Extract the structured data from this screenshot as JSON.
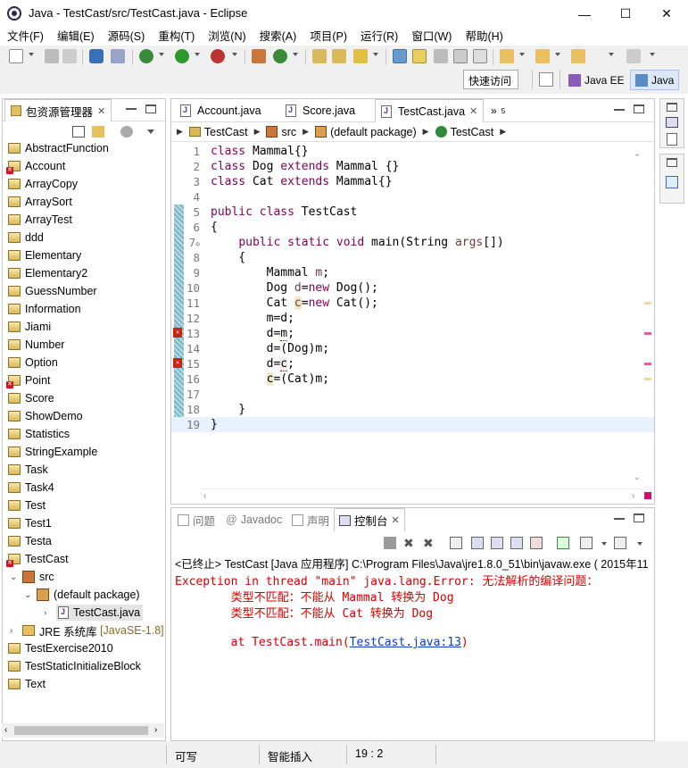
{
  "window": {
    "title": "Java - TestCast/src/TestCast.java - Eclipse",
    "minimize": "—",
    "maximize": "☐",
    "close": "✕"
  },
  "menu": [
    "文件(F)",
    "编辑(E)",
    "源码(S)",
    "重构(T)",
    "浏览(N)",
    "搜索(A)",
    "项目(P)",
    "运行(R)",
    "窗口(W)",
    "帮助(H)"
  ],
  "toolbar": {
    "quick_access": "快速访问",
    "perspective_javaee": "Java EE",
    "perspective_java": "Java"
  },
  "explorer": {
    "title": "包资源管理器",
    "projects": [
      {
        "name": "AbstractFunction",
        "error": false
      },
      {
        "name": "Account",
        "error": true
      },
      {
        "name": "ArrayCopy",
        "error": false
      },
      {
        "name": "ArraySort",
        "error": false
      },
      {
        "name": "ArrayTest",
        "error": false
      },
      {
        "name": "ddd",
        "error": false
      },
      {
        "name": "Elementary",
        "error": false
      },
      {
        "name": "Elementary2",
        "error": false
      },
      {
        "name": "GuessNumber",
        "error": false
      },
      {
        "name": "Information",
        "error": false
      },
      {
        "name": "Jiami",
        "error": false
      },
      {
        "name": "Number",
        "error": false
      },
      {
        "name": "Option",
        "error": false
      },
      {
        "name": "Point",
        "error": true
      },
      {
        "name": "Score",
        "error": false
      },
      {
        "name": "ShowDemo",
        "error": false
      },
      {
        "name": "Statistics",
        "error": false
      },
      {
        "name": "StringExample",
        "error": false
      },
      {
        "name": "Task",
        "error": false
      },
      {
        "name": "Task4",
        "error": false
      },
      {
        "name": "Test",
        "error": false
      },
      {
        "name": "Test1",
        "error": false
      },
      {
        "name": "Testa",
        "error": false
      },
      {
        "name": "TestCast",
        "error": true
      }
    ],
    "src": "src",
    "default_package": "(default package)",
    "file": "TestCast.java",
    "jre": "JRE 系统库",
    "jre_version": "[JavaSE-1.8]",
    "after": [
      "TestExercise2010",
      "TestStaticInitializeBlock",
      "Text"
    ]
  },
  "editor": {
    "tabs": [
      "Account.java",
      "Score.java",
      "TestCast.java"
    ],
    "overflow": "»",
    "overflow_count": "5",
    "breadcrumb": [
      "TestCast",
      "src",
      "(default package)",
      "TestCast"
    ]
  },
  "console": {
    "tabs": [
      "问题",
      "Javadoc",
      "声明",
      "控制台"
    ],
    "terminated": "<已终止> TestCast [Java 应用程序] C:\\Program Files\\Java\\jre1.8.0_51\\bin\\javaw.exe ( 2015年11",
    "line1": "Exception in thread \"main\" java.lang.Error: 无法解析的编译问题：",
    "line2": "        类型不匹配：不能从 Mammal 转换为 Dog",
    "line3": "        类型不匹配：不能从 Cat 转换为 Dog",
    "line4": "        at TestCast.main(",
    "link": "TestCast.java:13",
    "line4_end": ")"
  },
  "status": {
    "writable": "可写",
    "insert": "智能插入",
    "position": "19 : 2"
  }
}
